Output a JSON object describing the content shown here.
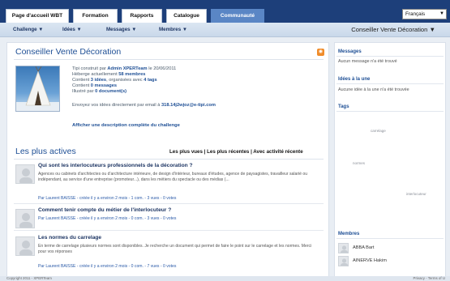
{
  "nav": {
    "tabs": [
      {
        "label": "Page d'accueil WBT"
      },
      {
        "label": "Formation"
      },
      {
        "label": "Rapports"
      },
      {
        "label": "Catalogue"
      },
      {
        "label": "Communauté",
        "active": true
      }
    ],
    "language": "Français"
  },
  "subnav": {
    "items": [
      {
        "label": "Challenge ▼"
      },
      {
        "label": "Idées ▼"
      },
      {
        "label": "Messages ▼"
      },
      {
        "label": "Membres ▼"
      }
    ],
    "current": "Conseiller Vente Décoration ▼"
  },
  "challenge": {
    "title": "Conseiller Vente Décoration",
    "built_prefix": "Tipi construit par ",
    "built_author": "Admin XPERTeam",
    "built_suffix": " le 20/06/2011",
    "hosts_prefix": "Héberge actuellement ",
    "hosts_count": "58 membres",
    "contains_prefix": "Contient ",
    "ideas_count": "3 idées",
    "contains_mid": ", organisées avec ",
    "tags_count": "4 tags",
    "messages_prefix": "Contient ",
    "messages_count": "0 messages",
    "docs_prefix": "Illustré par ",
    "docs_count": "0 document(s)",
    "email_prefix": "Envoyez vos idées directement par email à ",
    "email_address": "318.14j2wjoz@e-tipi.com",
    "show_desc": "Afficher une description complète du challenge"
  },
  "actives": {
    "heading": "Les plus actives",
    "sorts": "Les plus vues | Les plus récentes | Avec activité récente",
    "items": [
      {
        "title": "Qui sont les interlocuteurs professionnels de la décoration ?",
        "desc": "Agences ou cabinets d'architectes ou d'architecture intérieure, de design d'intérieur, bureaux d'études, agence de paysagistes, travailleur salarié ou indépendant, au service d'une entreprise (promoteur...), dans les métiers du spectacle ou des médias (...",
        "meta": "Par Laurent BAISSE - créée il y a environ 2 mois - 1 com. - 3 vues - 0 votes"
      },
      {
        "title": "Comment tenir compte du métier de l'interlocuteur ?",
        "desc": "",
        "meta": "Par Laurent BAISSE - créée il y a environ 2 mois - 0 com. - 3 vues - 0 votes"
      },
      {
        "title": "Les normes du carrelage",
        "desc": "En terme de carrelage plusieurs normes sont disponibles. Je recherche un document qui permet de faire le point sur le carrelage et les normes. Merci pour vos réponses",
        "meta": "Par Laurent BAISSE - créée il y a environ 2 mois - 0 com. - 7 vues - 0 votes"
      }
    ]
  },
  "sidebar": {
    "messages_heading": "Messages",
    "messages_empty": "Aucun message n'a été trouvé",
    "idea_heading": "Idées à la une",
    "idea_empty": "Aucune idée à la une n'a été trouvée",
    "tags_heading": "Tags",
    "tags": [
      "carrelage",
      "normes",
      "interlocuteur"
    ],
    "members_heading": "Membres",
    "members": [
      {
        "name": "ABBA Bart"
      },
      {
        "name": "AINERVE Hakim"
      }
    ]
  },
  "footer": {
    "left": "Copyright 2011 - XPERTeam",
    "right": "Privacy - Terms of U"
  }
}
